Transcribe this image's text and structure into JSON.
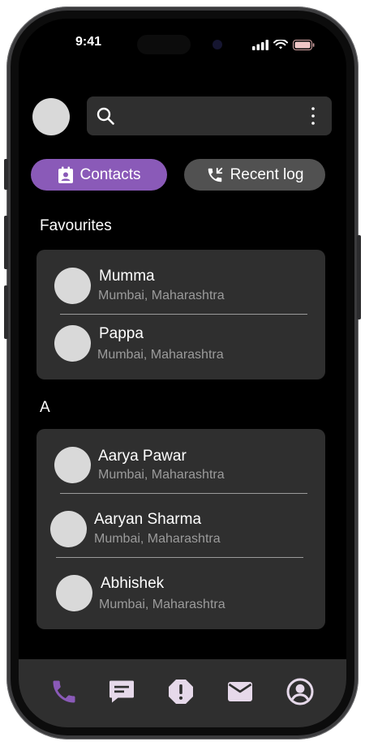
{
  "status_bar": {
    "time": "9:41"
  },
  "search": {
    "placeholder": ""
  },
  "tabs": [
    {
      "label": "Contacts",
      "active": true
    },
    {
      "label": "Recent log",
      "active": false
    }
  ],
  "sections": [
    {
      "title": "Favourites",
      "contacts": [
        {
          "name": "Mumma",
          "location": "Mumbai, Maharashtra"
        },
        {
          "name": "Pappa",
          "location": "Mumbai, Maharashtra"
        }
      ]
    },
    {
      "title": "A",
      "contacts": [
        {
          "name": "Aarya Pawar",
          "location": "Mumbai, Maharashtra"
        },
        {
          "name": "Aaryan Sharma",
          "location": "Mumbai, Maharashtra"
        },
        {
          "name": "Abhishek",
          "location": "Mumbai, Maharashtra"
        }
      ]
    }
  ],
  "bottom_nav": {
    "items": [
      {
        "icon": "phone-icon",
        "active": true
      },
      {
        "icon": "message-icon",
        "active": false
      },
      {
        "icon": "alert-icon",
        "active": false
      },
      {
        "icon": "mail-icon",
        "active": false
      },
      {
        "icon": "account-icon",
        "active": false
      }
    ]
  },
  "colors": {
    "accent": "#8a5ab8",
    "background": "#000000",
    "card": "#2f2f2f",
    "icon_inactive": "#e6d9ea"
  }
}
